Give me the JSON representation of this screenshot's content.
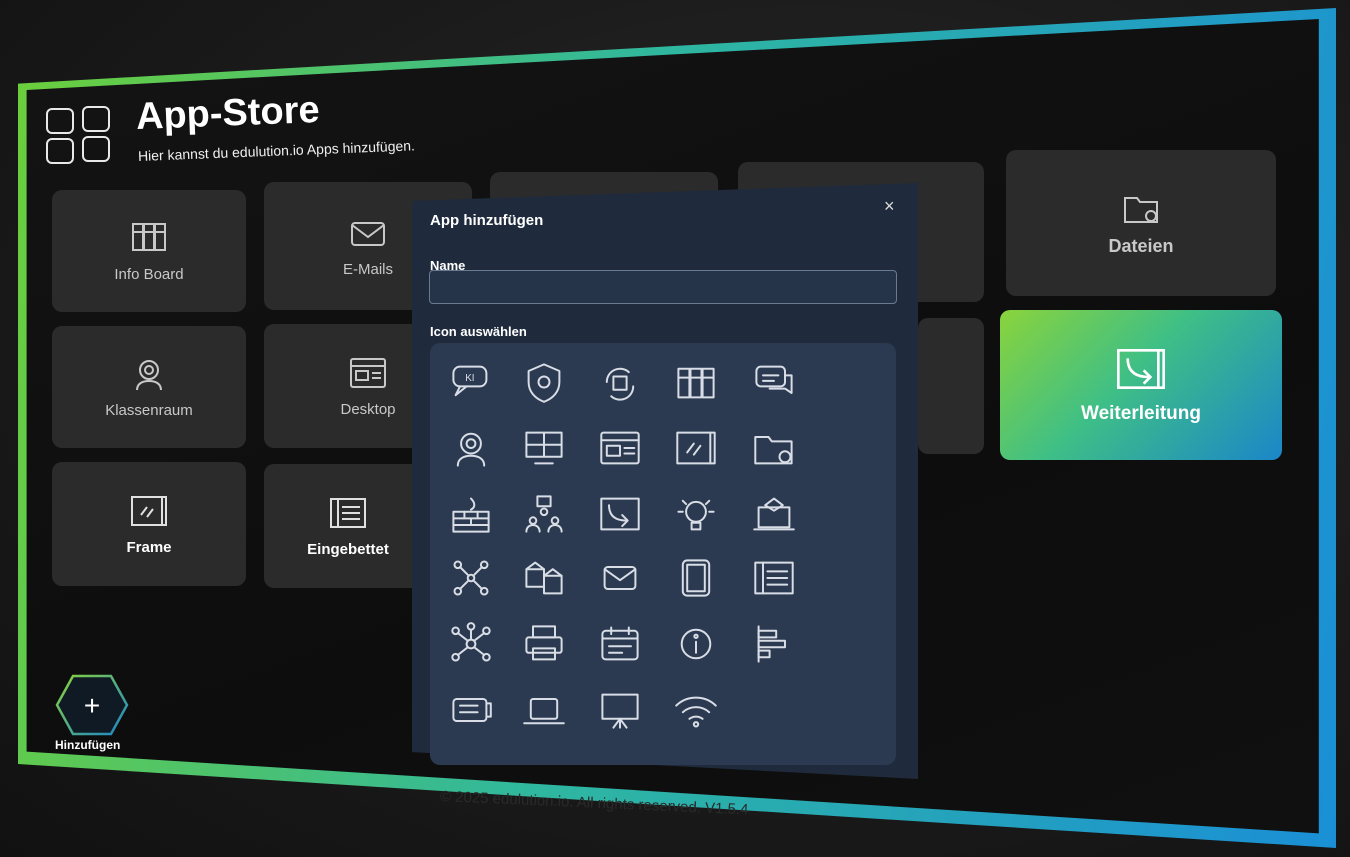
{
  "header": {
    "title": "App-Store",
    "subtitle": "Hier kannst du edulution.io Apps hinzufügen."
  },
  "tiles": [
    {
      "label": "Info Board",
      "icon": "info-board-icon"
    },
    {
      "label": "E-Mails",
      "icon": "mail-icon"
    },
    {
      "label": "Dateien",
      "icon": "file-share-icon"
    },
    {
      "label": "Klassenraum",
      "icon": "classroom-icon"
    },
    {
      "label": "Desktop",
      "icon": "desktop-icon"
    },
    {
      "label": "Weiterleitung",
      "icon": "forward-icon"
    },
    {
      "label": "Frame",
      "icon": "frame-icon"
    },
    {
      "label": "Eingebettet",
      "icon": "embedded-icon"
    }
  ],
  "modal": {
    "title": "App hinzufügen",
    "close": "×",
    "name_label": "Name",
    "name_value": "",
    "icon_label": "Icon auswählen",
    "icons": [
      "ki-chat-icon",
      "shield-bug-icon",
      "sync-icon",
      "info-board-icon",
      "chat-icon",
      "classroom-icon",
      "video-conference-icon",
      "desktop-icon",
      "frame-icon",
      "file-share-icon",
      "firewall-icon",
      "presenter-group-icon",
      "forward-icon",
      "lightbulb-icon",
      "learning-laptop-icon",
      "network-icon",
      "school-buildings-icon",
      "mail-icon",
      "tablet-icon",
      "embedded-icon",
      "hub-icon",
      "printer-icon",
      "calendar-icon",
      "info-icon",
      "bar-chart-icon",
      "tickets-icon",
      "laptop-icon",
      "presentation-board-icon",
      "wifi-icon"
    ]
  },
  "add_button": {
    "label": "Hinzufügen",
    "symbol": "+"
  },
  "footer": "© 2025 edulution.io. All rights reserved. V1.5.4",
  "colors": {
    "accent_green": "#8ad43b",
    "accent_blue": "#1b86c8",
    "modal_bg": "#1f2b3c"
  }
}
